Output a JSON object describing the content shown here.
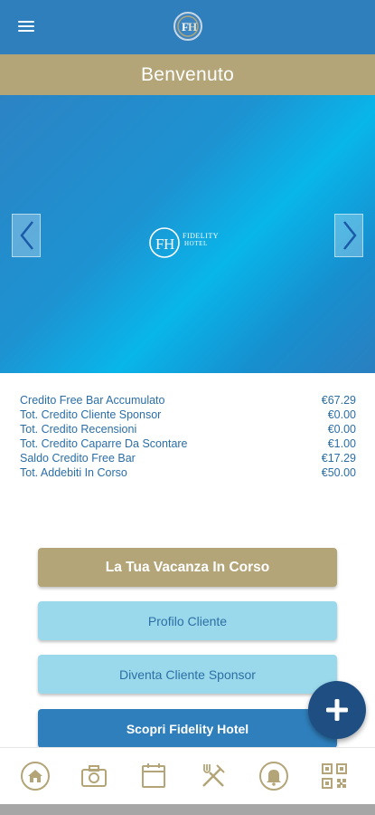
{
  "header": {
    "menu_icon": "hamburger-menu-icon",
    "logo_icon": "fidelity-hotel-logo-icon"
  },
  "title_bar": {
    "title": "Benvenuto"
  },
  "carousel": {
    "logo_text": "FIDELITY",
    "logo_subtext": "HOTEL",
    "prev_icon": "chevron-left-icon",
    "next_icon": "chevron-right-icon"
  },
  "credits": [
    {
      "label": "Credito Free Bar Accumulato",
      "value": "€67.29"
    },
    {
      "label": "Tot. Credito Cliente Sponsor",
      "value": "€0.00"
    },
    {
      "label": "Tot. Credito Recensioni",
      "value": "€0.00"
    },
    {
      "label": "Tot. Credito Caparre Da Scontare",
      "value": "€1.00"
    },
    {
      "label": "Saldo Credito Free Bar",
      "value": "€17.29"
    },
    {
      "label": "Tot. Addebiti In Corso",
      "value": "€50.00"
    }
  ],
  "buttons": {
    "vacanza": "La Tua Vacanza In Corso",
    "profilo": "Profilo Cliente",
    "sponsor": "Diventa Cliente Sponsor",
    "scopri": "Scopri Fidelity Hotel"
  },
  "fab": {
    "icon": "plus-icon"
  },
  "bottom_nav": [
    {
      "icon": "home-icon"
    },
    {
      "icon": "camera-icon"
    },
    {
      "icon": "calendar-icon"
    },
    {
      "icon": "restaurant-icon"
    },
    {
      "icon": "bell-icon"
    },
    {
      "icon": "qr-code-icon"
    }
  ],
  "colors": {
    "primary_blue": "#2f7fbd",
    "gold": "#b3a577",
    "light_blue": "#9ad9ec",
    "dark_blue": "#1e4e82",
    "text_blue": "#2b6ea6"
  }
}
